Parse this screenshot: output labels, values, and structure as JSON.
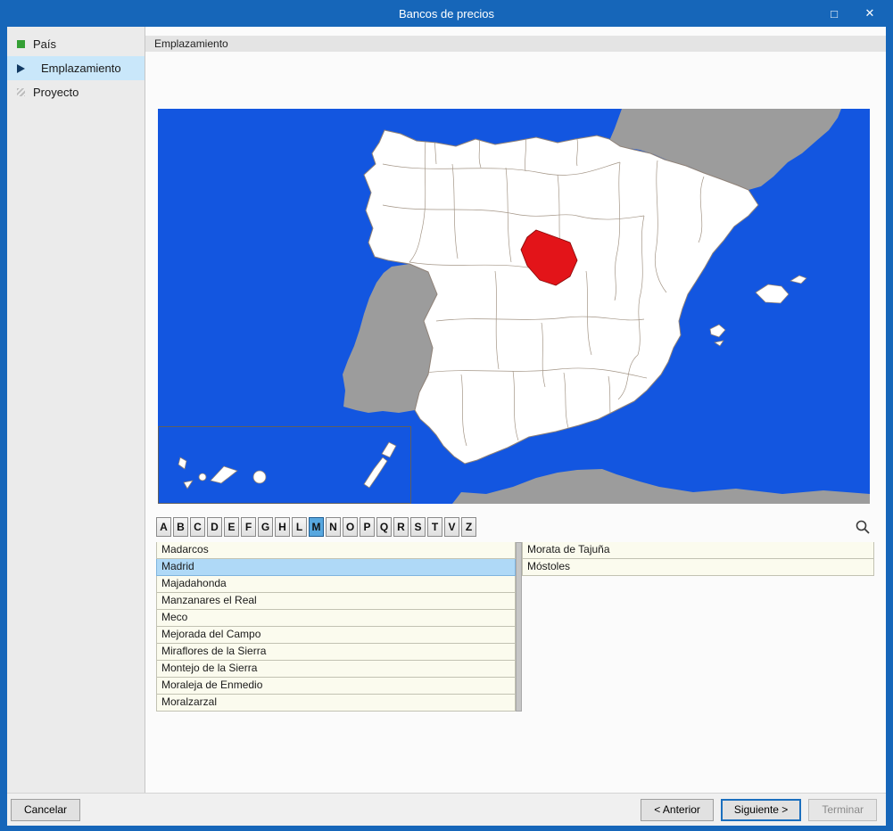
{
  "window": {
    "title": "Bancos de precios"
  },
  "titlebar": {
    "maximize_glyph": "□",
    "close_glyph": "✕"
  },
  "sidebar": {
    "steps": [
      {
        "label": "País",
        "state": "done"
      },
      {
        "label": "Emplazamiento",
        "state": "current"
      },
      {
        "label": "Proyecto",
        "state": "pending"
      }
    ],
    "active_step": "Emplazamiento"
  },
  "main": {
    "section_header": "Emplazamiento"
  },
  "map": {
    "selected_region": "Madrid"
  },
  "letter_bar": {
    "letters": [
      "A",
      "B",
      "C",
      "D",
      "E",
      "F",
      "G",
      "H",
      "L",
      "M",
      "N",
      "O",
      "P",
      "Q",
      "R",
      "S",
      "T",
      "V",
      "Z"
    ],
    "selected": "M"
  },
  "municipalities": {
    "selected": "Madrid",
    "column1": [
      "Madarcos",
      "Madrid",
      "Majadahonda",
      "Manzanares el Real",
      "Meco",
      "Mejorada del Campo",
      "Miraflores de la Sierra",
      "Montejo de la Sierra",
      "Moraleja de Enmedio",
      "Moralzarzal"
    ],
    "column2": [
      "Morata de Tajuña",
      "Móstoles"
    ]
  },
  "footer": {
    "cancel_label": "Cancelar",
    "previous_label": "< Anterior",
    "next_label": "Siguiente >",
    "finish_label": "Terminar"
  },
  "colors": {
    "titlebar_blue": "#1666B9",
    "map_sea": "#1356E0",
    "neighbor_land": "#9C9C9C",
    "spain_fill": "#FFFFFF",
    "selected_region_red": "#E31419",
    "list_row_cream": "#FBFBEE",
    "selection_blue": "#AFD9F7",
    "letter_selected_blue": "#57A7DF",
    "sidebar_selected_blue": "#C9E7FA"
  }
}
